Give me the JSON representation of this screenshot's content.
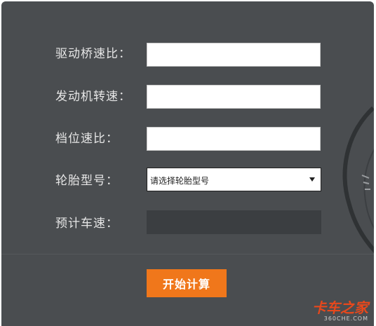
{
  "form": {
    "axle_ratio_label": "驱动桥速比：",
    "axle_ratio_value": "",
    "engine_speed_label": "发动机转速：",
    "engine_speed_value": "",
    "gear_ratio_label": "档位速比：",
    "gear_ratio_value": "",
    "tire_model_label": "轮胎型号：",
    "tire_model_selected": "请选择轮胎型号",
    "estimated_speed_label": "预计车速：",
    "estimated_speed_value": "",
    "calculate_button": "开始计算"
  },
  "watermark": {
    "brand": "卡车之家",
    "domain": "360CHE.COM"
  },
  "colors": {
    "panel_bg": "#4a4d50",
    "result_bg": "#3b3e41",
    "button_bg": "#f0771b",
    "watermark": "#e8481c"
  }
}
